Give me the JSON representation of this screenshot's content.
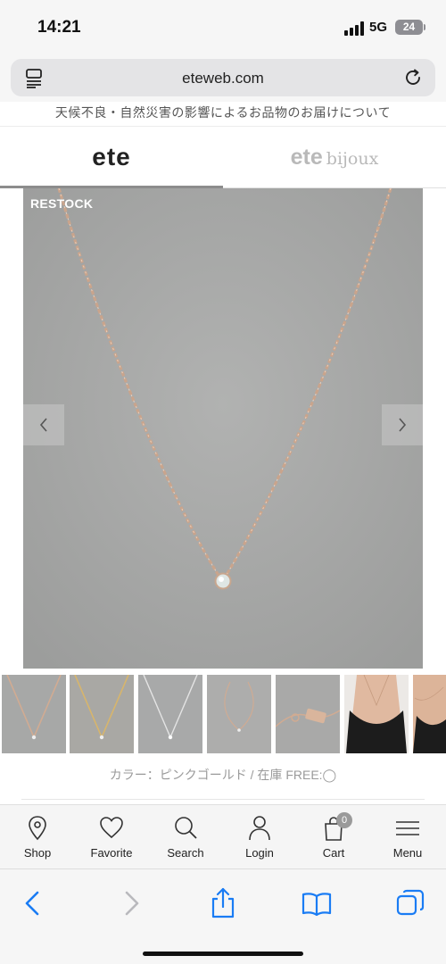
{
  "status_bar": {
    "time": "14:21",
    "network": "5G",
    "battery": "24"
  },
  "browser": {
    "url": "eteweb.com"
  },
  "notice": {
    "text": "天候不良・自然災害の影響によるお品物のお届けについて"
  },
  "brand_tabs": {
    "active": "ete",
    "bijoux_brand": "ete",
    "bijoux_suffix": "bijoux"
  },
  "product": {
    "badge": "RESTOCK",
    "color_stock": "カラー：ピンクゴールド / 在庫 FREE:◯",
    "thumbnails": [
      {
        "variant": "pink-gold"
      },
      {
        "variant": "yellow-gold"
      },
      {
        "variant": "silver"
      },
      {
        "variant": "full-chain"
      },
      {
        "variant": "clasp-detail"
      },
      {
        "variant": "model-worn"
      },
      {
        "variant": "model-closeup"
      }
    ]
  },
  "bottom_nav": {
    "items": [
      {
        "label": "Shop",
        "icon": "location-pin-icon"
      },
      {
        "label": "Favorite",
        "icon": "heart-icon"
      },
      {
        "label": "Search",
        "icon": "search-icon"
      },
      {
        "label": "Login",
        "icon": "user-icon"
      },
      {
        "label": "Cart",
        "icon": "cart-icon",
        "badge": "0"
      },
      {
        "label": "Menu",
        "icon": "hamburger-menu-icon"
      }
    ]
  },
  "colors": {
    "image_background": "#a8a9a8",
    "chain": "#d8b39a",
    "ios_blue": "#1a7cf4",
    "badge_gray": "#9a9a9a"
  }
}
